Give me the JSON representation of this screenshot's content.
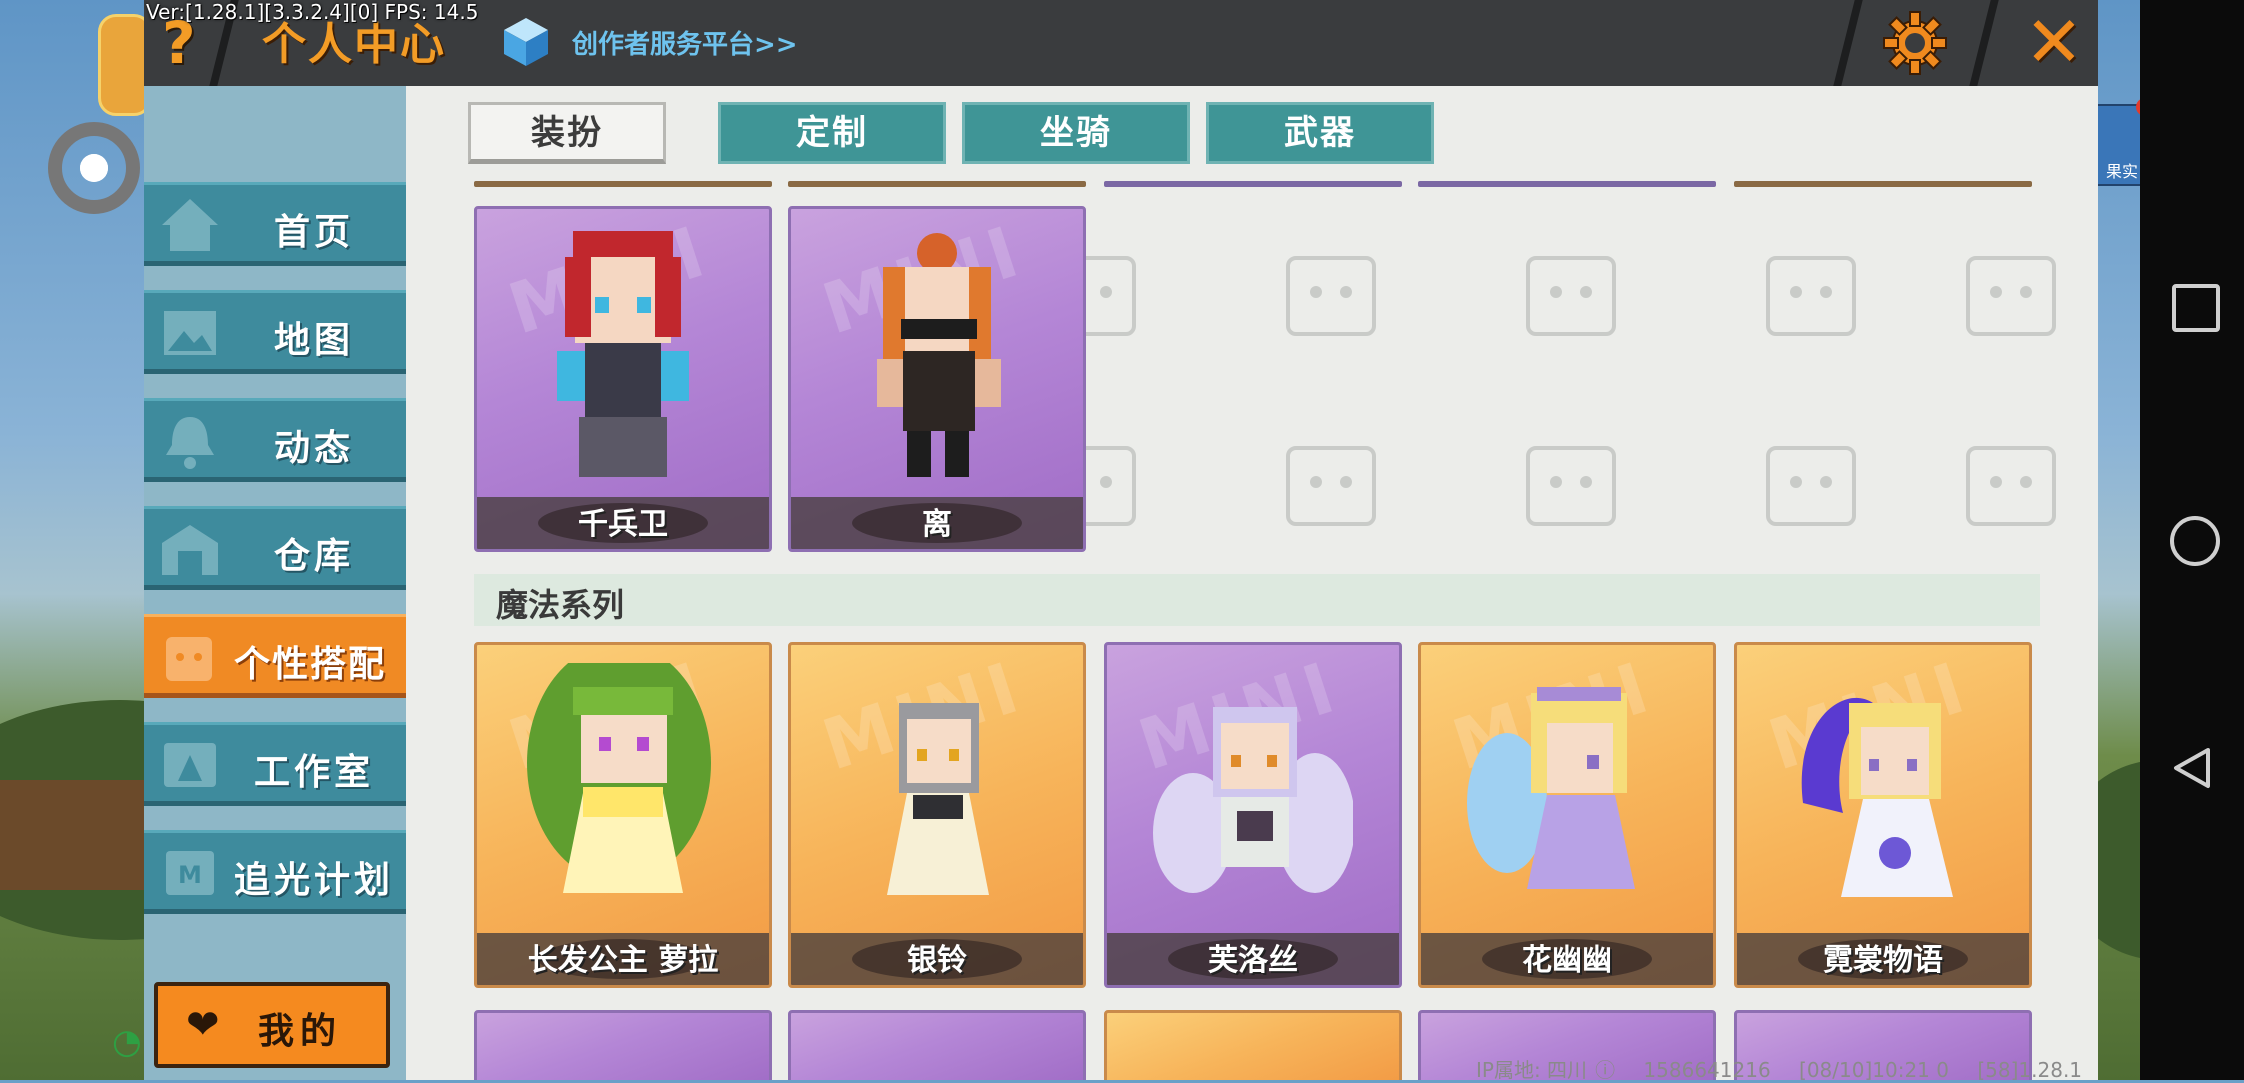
{
  "version_text": "Ver:[1.28.1][3.3.2.4][0] FPS: 14.5",
  "header": {
    "title": "个人中心",
    "creator_link": "创作者服务平台>>",
    "help_label": "?",
    "close_label": "✕"
  },
  "sidebar": {
    "items": [
      {
        "label": "首页",
        "icon": "house-icon"
      },
      {
        "label": "地图",
        "icon": "map-icon"
      },
      {
        "label": "动态",
        "icon": "bell-icon"
      },
      {
        "label": "仓库",
        "icon": "warehouse-icon"
      },
      {
        "label": "个性搭配",
        "icon": "outfit-icon",
        "active": true
      },
      {
        "label": "工作室",
        "icon": "studio-icon"
      },
      {
        "label": "追光计划",
        "icon": "light-plan-icon"
      }
    ],
    "mine_label": "我的"
  },
  "tabs": [
    {
      "label": "装扮",
      "active": true
    },
    {
      "label": "定制",
      "active": false
    },
    {
      "label": "坐骑",
      "active": false
    },
    {
      "label": "武器",
      "active": false
    }
  ],
  "row1_cards": [
    {
      "name": "千兵卫",
      "bg": "purple"
    },
    {
      "name": "离",
      "bg": "purple"
    }
  ],
  "section_title": "魔法系列",
  "row2_cards": [
    {
      "name": "长发公主 萝拉",
      "bg": "orange"
    },
    {
      "name": "银铃",
      "bg": "orange"
    },
    {
      "name": "芙洛丝",
      "bg": "purple"
    },
    {
      "name": "花幽幽",
      "bg": "orange"
    },
    {
      "name": "霓裳物语",
      "bg": "orange"
    }
  ],
  "card_watermark": "MINI",
  "hud": {
    "right_badge_text": "果实"
  },
  "status_bar": {
    "ip_location": "IP属地: 四川",
    "uid": "1586641216",
    "datetime": "[08/10]10:21 0",
    "build": "[58]1.28.1"
  },
  "colors": {
    "accent_orange": "#f08a24",
    "sidebar_teal": "#3e8b9d",
    "title_bar": "#3a3c3e",
    "link_blue": "#6ec3ee"
  }
}
